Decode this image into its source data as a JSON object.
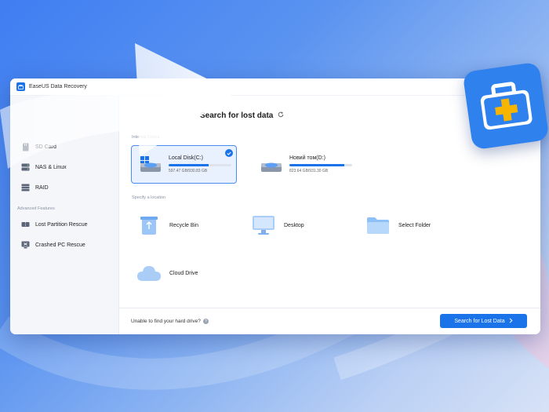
{
  "app": {
    "title": "EaseUS Data Recovery"
  },
  "main": {
    "title": "Search for lost data"
  },
  "sidebar": {
    "items": [
      {
        "label": "SD Card",
        "icon": "sd-card-icon"
      },
      {
        "label": "NAS & Linux",
        "icon": "nas-icon"
      },
      {
        "label": "RAID",
        "icon": "raid-icon"
      }
    ],
    "advanced_label": "Advanced Features",
    "advanced_items": [
      {
        "label": "Lost Partition Rescue",
        "icon": "partition-icon"
      },
      {
        "label": "Crashed PC Rescue",
        "icon": "crashed-pc-icon"
      }
    ]
  },
  "drives": {
    "section_label": "Internal Drives",
    "items": [
      {
        "name": "Local Disk(C:)",
        "size": "597.47 GB/930.83 GB",
        "used_fraction": 0.64,
        "selected": true
      },
      {
        "name": "Новий том(D:)",
        "size": "823.64 GB/931.30 GB",
        "used_fraction": 0.88,
        "selected": false
      }
    ]
  },
  "locations": {
    "section_label": "Specify a location",
    "items": [
      {
        "label": "Recycle Bin",
        "icon": "recycle-bin-icon"
      },
      {
        "label": "Desktop",
        "icon": "desktop-icon"
      },
      {
        "label": "Select Folder",
        "icon": "folder-icon"
      },
      {
        "label": "Cloud Drive",
        "icon": "cloud-icon"
      }
    ]
  },
  "footer": {
    "hint": "Unable to find your hard drive?",
    "hint_icon": "question-icon",
    "search_button": "Search for Lost Data",
    "search_button_icon": "chevron-right-icon"
  },
  "colors": {
    "accent": "#1a73e8",
    "selected_bg": "#e9f1fe",
    "sidebar_bg": "#f4f6fa"
  }
}
